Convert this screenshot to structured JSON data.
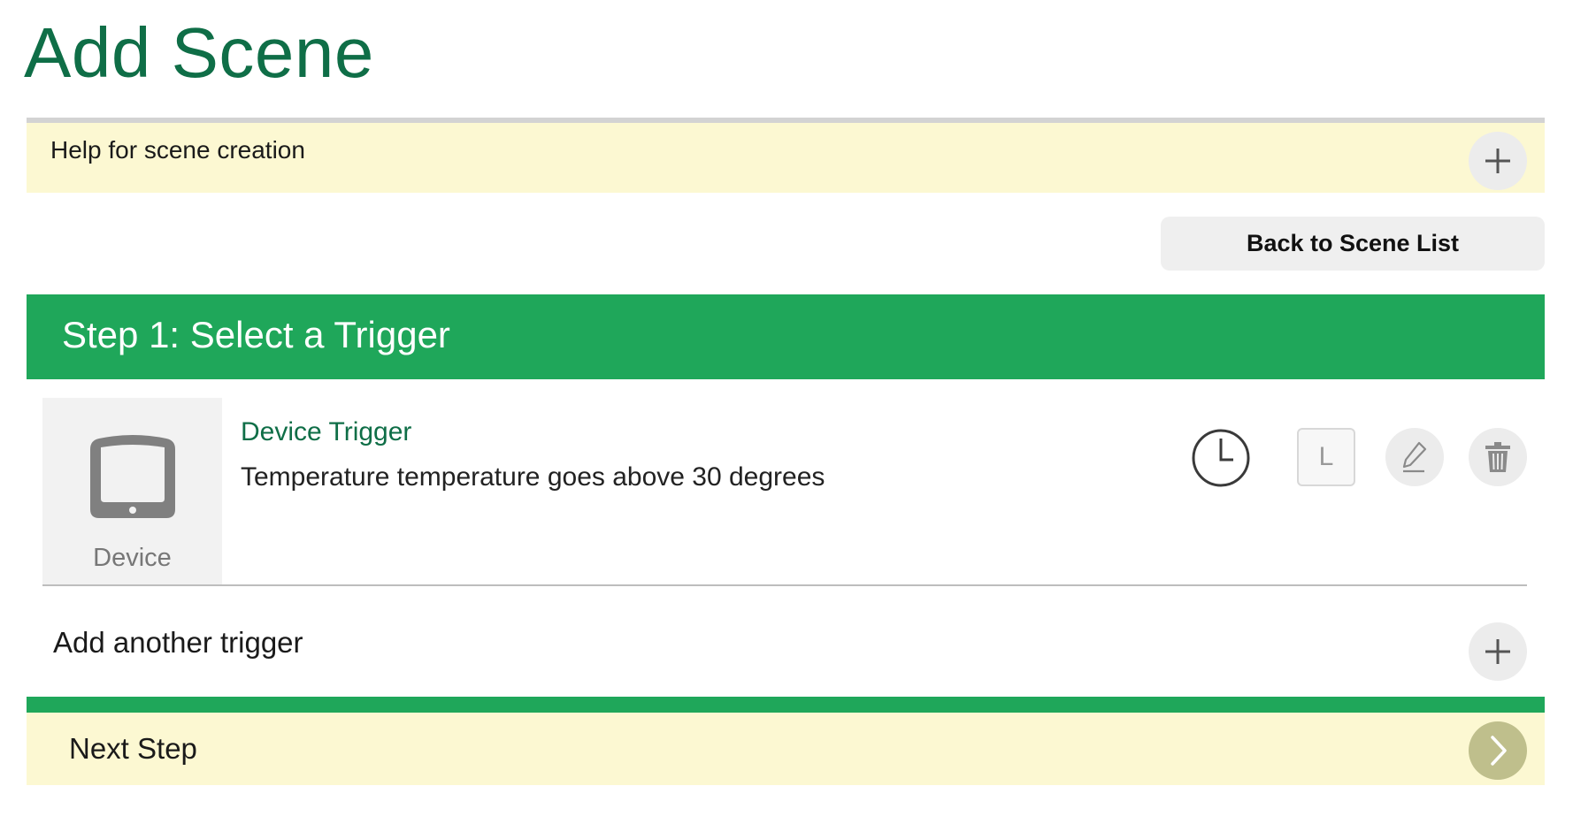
{
  "page": {
    "title": "Add Scene"
  },
  "help": {
    "label": "Help for scene creation",
    "expand_icon": "plus-icon"
  },
  "actions": {
    "back_label": "Back to Scene List"
  },
  "step": {
    "title": "Step 1: Select a Trigger"
  },
  "trigger": {
    "tile_label": "Device",
    "tile_icon": "device-tablet-icon",
    "title": "Device Trigger",
    "description": "Temperature temperature goes above 30 degrees",
    "l_button_label": "L",
    "icons": [
      "clock-icon",
      "pencil-icon",
      "trash-icon"
    ]
  },
  "add_trigger": {
    "label": "Add another trigger",
    "icon": "plus-icon"
  },
  "next": {
    "label": "Next Step",
    "icon": "chevron-right-icon"
  },
  "colors": {
    "brand_green": "#1fa75a",
    "title_green": "#0f6e47",
    "panel_yellow": "#fcf8d2",
    "next_button": "#bfbf8c"
  }
}
